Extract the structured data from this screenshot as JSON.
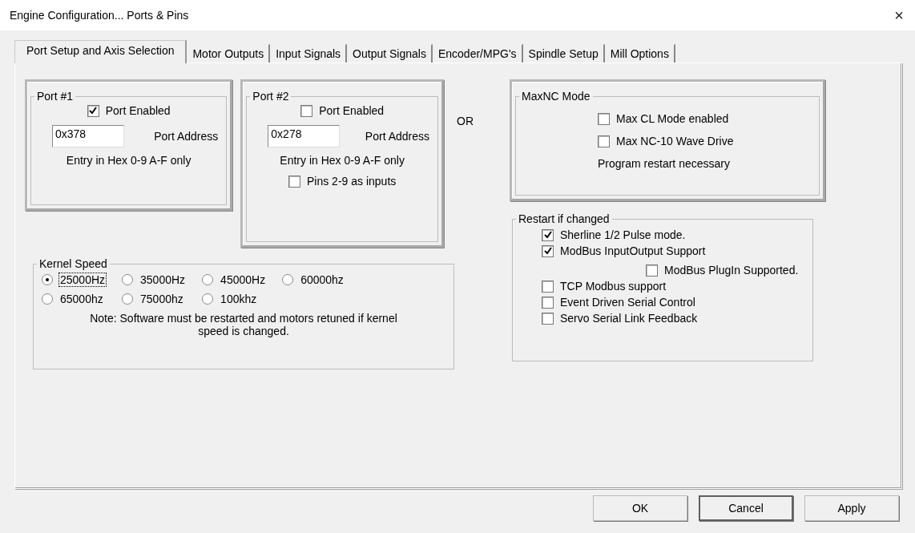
{
  "window": {
    "title": "Engine Configuration... Ports & Pins",
    "close": "×"
  },
  "tabs": [
    {
      "label": "Port Setup and Axis Selection",
      "selected": true
    },
    {
      "label": "Motor Outputs",
      "selected": false
    },
    {
      "label": "Input Signals",
      "selected": false
    },
    {
      "label": "Output Signals",
      "selected": false
    },
    {
      "label": "Encoder/MPG's",
      "selected": false
    },
    {
      "label": "Spindle Setup",
      "selected": false
    },
    {
      "label": "Mill Options",
      "selected": false
    }
  ],
  "ports": [
    {
      "title": "Port #1",
      "enabled": {
        "label": "Port Enabled",
        "checked": true
      },
      "address": "0x378",
      "address_label": "Port Address",
      "hint": "Entry in Hex 0-9 A-F only"
    },
    {
      "title": "Port #2",
      "enabled": {
        "label": "Port Enabled",
        "checked": false
      },
      "address": "0x278",
      "address_label": "Port Address",
      "hint": "Entry in Hex 0-9 A-F only",
      "extra": {
        "label": "Pins 2-9 as inputs",
        "checked": false
      }
    }
  ],
  "or_label": "OR",
  "kernel_speed": {
    "title": "Kernel Speed",
    "options": [
      {
        "label": "25000Hz",
        "selected": true
      },
      {
        "label": "35000Hz",
        "selected": false
      },
      {
        "label": "45000Hz",
        "selected": false
      },
      {
        "label": "60000hz",
        "selected": false
      },
      {
        "label": "65000hz",
        "selected": false
      },
      {
        "label": "75000hz",
        "selected": false
      },
      {
        "label": "100khz",
        "selected": false
      }
    ],
    "note": "Note: Software must be restarted and motors retuned if kernel speed is changed."
  },
  "maxnc": {
    "title": "MaxNC Mode",
    "options": [
      {
        "label": "Max CL Mode enabled",
        "checked": false
      },
      {
        "label": "Max NC-10 Wave Drive",
        "checked": false
      }
    ],
    "note": "Program restart necessary"
  },
  "restart": {
    "title": "Restart if changed",
    "options": [
      {
        "label": "Sherline 1/2 Pulse mode.",
        "checked": true
      },
      {
        "label": "ModBus InputOutput Support",
        "checked": true,
        "children": [
          {
            "label": "ModBus PlugIn Supported.",
            "checked": false
          }
        ]
      },
      {
        "label": "TCP Modbus support",
        "checked": false
      },
      {
        "label": "Event Driven Serial Control",
        "checked": false
      },
      {
        "label": "Servo Serial Link Feedback",
        "checked": false
      }
    ]
  },
  "buttons": [
    {
      "label": "OK",
      "focused": false
    },
    {
      "label": "Cancel",
      "focused": true
    },
    {
      "label": "Apply",
      "focused": false
    }
  ]
}
